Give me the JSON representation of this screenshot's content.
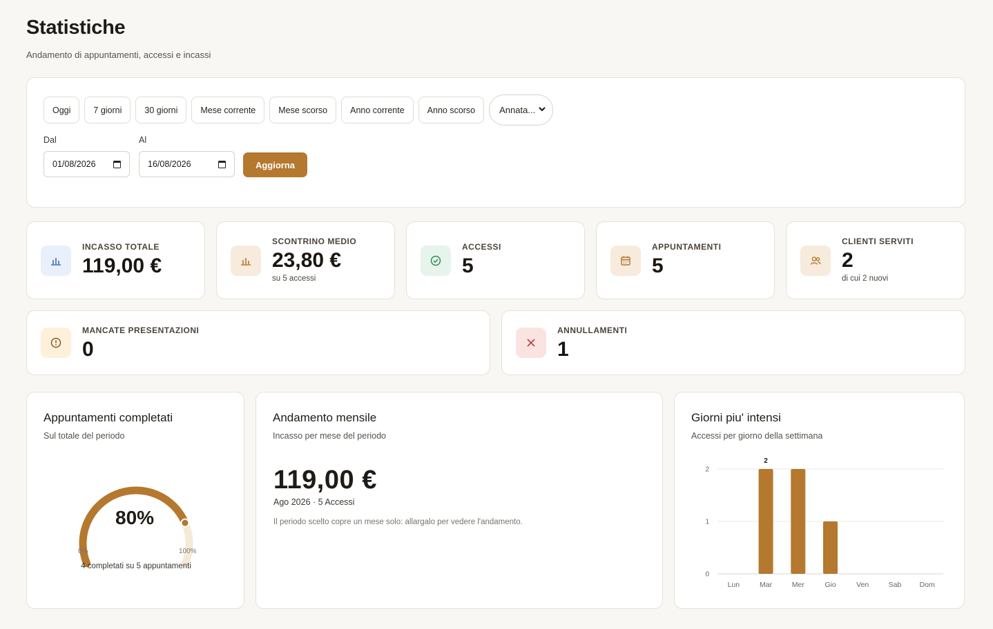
{
  "page": {
    "title": "Statistiche",
    "subtitle": "Andamento di appuntamenti, accessi e incassi"
  },
  "filters": {
    "presets": [
      "Oggi",
      "7 giorni",
      "30 giorni",
      "Mese corrente",
      "Mese scorso",
      "Anno corrente",
      "Anno scorso"
    ],
    "year_select": "Annata...",
    "from_label": "Dal",
    "from_value": "01/08/2026",
    "to_label": "Al",
    "to_value": "16/08/2026",
    "refresh_label": "Aggiorna"
  },
  "kpis": {
    "incasso": {
      "label": "INCASSO TOTALE",
      "value": "119,00 €",
      "icon": "bar-chart-icon"
    },
    "scontrino": {
      "label": "SCONTRINO MEDIO",
      "value": "23,80 €",
      "sub": "su 5 accessi",
      "icon": "bar-chart-icon"
    },
    "accessi": {
      "label": "ACCESSI",
      "value": "5",
      "icon": "check-circle-icon"
    },
    "appuntamenti": {
      "label": "APPUNTAMENTI",
      "value": "5",
      "icon": "calendar-icon"
    },
    "clienti": {
      "label": "CLIENTI SERVITI",
      "value": "2",
      "sub": "di cui 2 nuovi",
      "icon": "users-icon"
    },
    "mancate": {
      "label": "MANCATE PRESENTAZIONI",
      "value": "0",
      "icon": "alert-circle-icon"
    },
    "annullamenti": {
      "label": "ANNULLAMENTI",
      "value": "1",
      "icon": "x-icon"
    }
  },
  "completed": {
    "title": "Appuntamenti completati",
    "subtitle": "Sul totale del periodo",
    "percent_label": "80%",
    "percent_value": 0.8,
    "min_label": "0%",
    "max_label": "100%",
    "caption": "4 completati su 5 appuntamenti"
  },
  "trend": {
    "title": "Andamento mensile",
    "subtitle": "Incasso per mese del periodo",
    "amount": "119,00 €",
    "meta": "Ago 2026 · 5 Accessi",
    "note": "Il periodo scelto copre un mese solo: allargalo per vedere l'andamento."
  },
  "busy_days": {
    "title": "Giorni piu' intensi",
    "subtitle": "Accessi per giorno della settimana"
  },
  "colors": {
    "accent": "#b5782f",
    "track": "#f5e9d8"
  },
  "chart_data": {
    "type": "bar",
    "categories": [
      "Lun",
      "Mar",
      "Mer",
      "Gio",
      "Ven",
      "Sab",
      "Dom"
    ],
    "values": [
      0,
      2,
      2,
      1,
      0,
      0,
      0
    ],
    "ylim": [
      0,
      2
    ],
    "yticks": [
      0,
      1,
      2
    ],
    "data_labels": {
      "Mar": "2"
    },
    "grid": true
  }
}
